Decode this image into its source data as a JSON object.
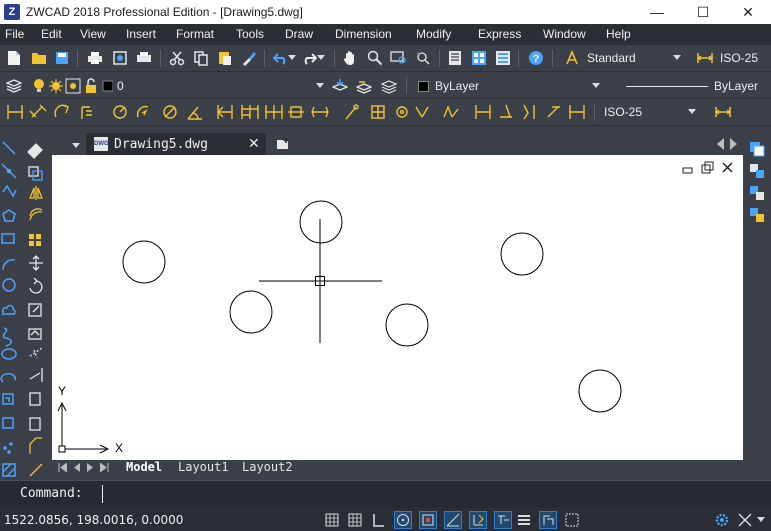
{
  "window": {
    "title": "ZWCAD 2018 Professional Edition - [Drawing5.dwg]",
    "app_icon_glyph": "Z",
    "minimize_glyph": "—",
    "maximize_glyph": "☐",
    "close_glyph": "✕"
  },
  "menubar": {
    "items": [
      "File",
      "Edit",
      "View",
      "Insert",
      "Format",
      "Tools",
      "Draw",
      "Dimension",
      "Modify",
      "Express",
      "Window",
      "Help"
    ]
  },
  "toolbar1": {
    "text_style": "Standard",
    "dim_style": "ISO-25"
  },
  "toolbar2": {
    "layer_value": "0",
    "color_value": "ByLayer",
    "linetype_value": "ByLayer"
  },
  "toolbar3": {
    "dim_style": "ISO-25"
  },
  "tabs": {
    "document": "Drawing5.dwg",
    "doc_badge": "DWG"
  },
  "canvas": {
    "ucs_y_label": "Y",
    "ucs_x_label": "X"
  },
  "layout_tabs": [
    "Model",
    "Layout1",
    "Layout2"
  ],
  "command": {
    "prompt": "Command:"
  },
  "status": {
    "coordinates": "1522.0856, 198.0016, 0.0000"
  },
  "colors": {
    "accent": "#2f7fd0",
    "toolbar_bg": "#3c4049",
    "canvas_bg": "#ffffff",
    "icon_yellow": "#f2c230",
    "icon_blue": "#4aa3ff"
  }
}
